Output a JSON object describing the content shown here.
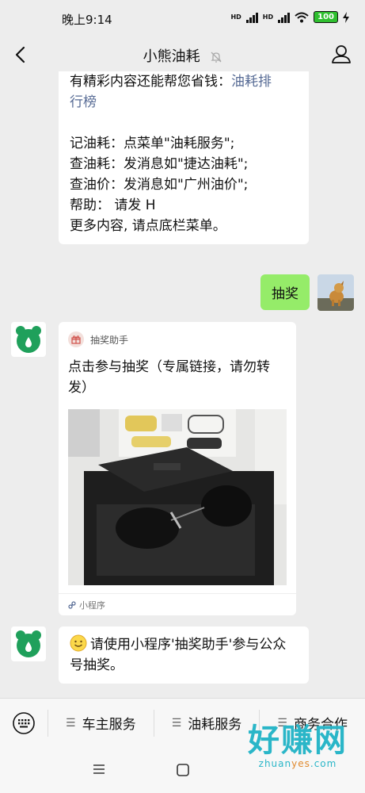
{
  "status_bar": {
    "time": "晚上9:14",
    "battery": "100",
    "signal_label": "HD"
  },
  "header": {
    "title": "小熊油耗"
  },
  "messages": {
    "intro": {
      "line1_prefix": "有精彩内容还能帮您省钱：",
      "line1_link": "油耗排",
      "line2_link": "行榜",
      "lines": [
        "记油耗：点菜单\"油耗服务\";",
        "查油耗：发消息如\"捷达油耗\";",
        "查油价：发消息如\"广州油价\";",
        "帮助：  请发 H",
        "更多内容, 请点底栏菜单。"
      ]
    },
    "user_msg": "抽奖",
    "card": {
      "source": "抽奖助手",
      "title": "点击参与抽奖（专属链接，请勿转发）",
      "footer": "小程序"
    },
    "reply": "请使用小程序'抽奖助手'参与公众号抽奖。"
  },
  "menu": {
    "items": [
      "车主服务",
      "油耗服务",
      "商务合作"
    ]
  },
  "watermark": {
    "big": "好赚网",
    "small_a": "zhuan",
    "small_b": "yes",
    "small_c": ".com"
  },
  "colors": {
    "link": "#576b95",
    "user_bubble": "#95ec69",
    "bear_green": "#1fa05b"
  }
}
